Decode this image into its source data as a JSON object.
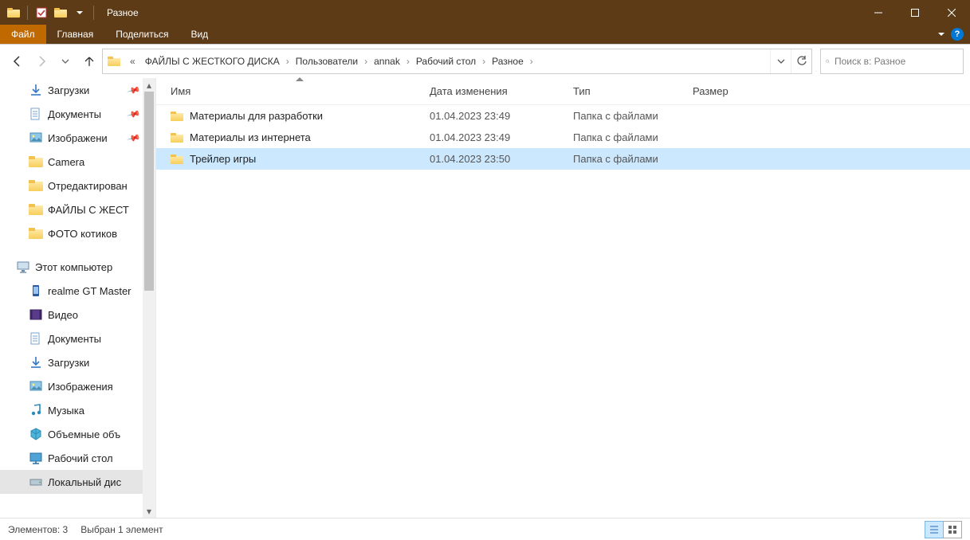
{
  "window": {
    "title": "Разное"
  },
  "ribbon": {
    "file": "Файл",
    "tabs": [
      "Главная",
      "Поделиться",
      "Вид"
    ]
  },
  "breadcrumb": {
    "prefix": "«",
    "items": [
      "ФАЙЛЫ С ЖЕСТКОГО ДИСКА",
      "Пользователи",
      "annak",
      "Рабочий стол",
      "Разное"
    ]
  },
  "search": {
    "placeholder": "Поиск в: Разное"
  },
  "sidebar": {
    "items": [
      {
        "label": "Загрузки",
        "icon": "download",
        "pinned": true,
        "depth": 1
      },
      {
        "label": "Документы",
        "icon": "doc",
        "pinned": true,
        "depth": 1
      },
      {
        "label": "Изображени",
        "icon": "image",
        "pinned": true,
        "depth": 1
      },
      {
        "label": "Camera",
        "icon": "folder",
        "depth": 1
      },
      {
        "label": "Отредактирован",
        "icon": "folder",
        "depth": 1
      },
      {
        "label": "ФАЙЛЫ С ЖЕСТ",
        "icon": "folder",
        "depth": 1
      },
      {
        "label": "ФОТО котиков",
        "icon": "folder",
        "depth": 1
      },
      {
        "label": "",
        "spacer": true
      },
      {
        "label": "Этот компьютер",
        "icon": "pc",
        "depth": 0
      },
      {
        "label": "realme GT Master",
        "icon": "phone",
        "depth": 1
      },
      {
        "label": "Видео",
        "icon": "video",
        "depth": 1
      },
      {
        "label": "Документы",
        "icon": "doc",
        "depth": 1
      },
      {
        "label": "Загрузки",
        "icon": "download",
        "depth": 1
      },
      {
        "label": "Изображения",
        "icon": "image",
        "depth": 1
      },
      {
        "label": "Музыка",
        "icon": "music",
        "depth": 1
      },
      {
        "label": "Объемные объ",
        "icon": "3d",
        "depth": 1
      },
      {
        "label": "Рабочий стол",
        "icon": "desktop",
        "depth": 1
      },
      {
        "label": "Локальный дис",
        "icon": "disk",
        "depth": 1,
        "selected": true
      }
    ]
  },
  "columns": {
    "name": "Имя",
    "date": "Дата изменения",
    "type": "Тип",
    "size": "Размер"
  },
  "files": [
    {
      "name": "Материалы для разработки",
      "date": "01.04.2023 23:49",
      "type": "Папка с файлами",
      "size": ""
    },
    {
      "name": "Материалы из интернета",
      "date": "01.04.2023 23:49",
      "type": "Папка с файлами",
      "size": ""
    },
    {
      "name": "Трейлер игры",
      "date": "01.04.2023 23:50",
      "type": "Папка с файлами",
      "size": "",
      "selected": true
    }
  ],
  "status": {
    "count": "Элементов: 3",
    "selected": "Выбран 1 элемент"
  }
}
